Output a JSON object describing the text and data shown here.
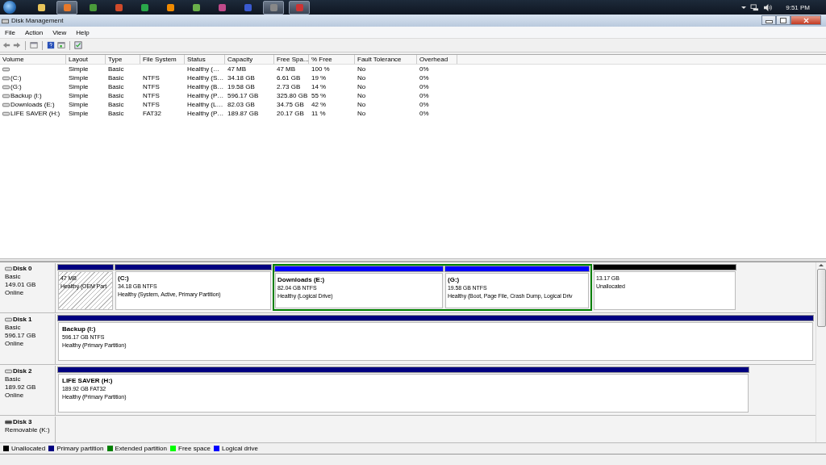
{
  "taskbar": {
    "apps": [
      {
        "selected": false
      },
      {
        "selected": true
      },
      {
        "selected": false
      },
      {
        "selected": false
      },
      {
        "selected": false
      },
      {
        "selected": false
      },
      {
        "selected": false
      },
      {
        "selected": false
      },
      {
        "selected": false
      },
      {
        "selected": true
      },
      {
        "selected": true
      }
    ],
    "clock": "9:51 PM"
  },
  "window": {
    "title": "Disk Management"
  },
  "menu": [
    "File",
    "Action",
    "View",
    "Help"
  ],
  "volumes": {
    "columns": [
      "Volume",
      "Layout",
      "Type",
      "File System",
      "Status",
      "Capacity",
      "Free Spa...",
      "% Free",
      "Fault Tolerance",
      "Overhead"
    ],
    "rows": [
      [
        "",
        "Simple",
        "Basic",
        "",
        "Healthy (…",
        "47 MB",
        "47 MB",
        "100 %",
        "No",
        "0%"
      ],
      [
        "(C:)",
        "Simple",
        "Basic",
        "NTFS",
        "Healthy (S…",
        "34.18 GB",
        "6.61 GB",
        "19 %",
        "No",
        "0%"
      ],
      [
        "(G:)",
        "Simple",
        "Basic",
        "NTFS",
        "Healthy (B…",
        "19.58 GB",
        "2.73 GB",
        "14 %",
        "No",
        "0%"
      ],
      [
        "Backup (I:)",
        "Simple",
        "Basic",
        "NTFS",
        "Healthy (P…",
        "596.17 GB",
        "325.80 GB",
        "55 %",
        "No",
        "0%"
      ],
      [
        "Downloads (E:)",
        "Simple",
        "Basic",
        "NTFS",
        "Healthy (L…",
        "82.03 GB",
        "34.75 GB",
        "42 %",
        "No",
        "0%"
      ],
      [
        "LIFE SAVER (H:)",
        "Simple",
        "Basic",
        "FAT32",
        "Healthy (P…",
        "189.87 GB",
        "20.17 GB",
        "11 %",
        "No",
        "0%"
      ]
    ]
  },
  "disks": [
    {
      "name": "Disk 0",
      "kind": "fixed",
      "lines": [
        "Basic",
        "149.01 GB",
        "Online"
      ],
      "partitions": [
        {
          "kind": "primary",
          "selected": true,
          "lines": [
            "47 MB",
            "Healthy (OEM Part"
          ]
        },
        {
          "kind": "primary",
          "selected": false,
          "label": "(C:)",
          "lines": [
            "34.18 GB NTFS",
            "Healthy (System, Active, Primary Partition)"
          ]
        },
        {
          "kind": "extended",
          "children": [
            {
              "kind": "logical",
              "selected": false,
              "label": "Downloads  (E:)",
              "lines": [
                "82.04 GB NTFS",
                "Healthy (Logical Drive)"
              ]
            },
            {
              "kind": "logical",
              "selected": false,
              "label": "(G:)",
              "lines": [
                "19.58 GB NTFS",
                "Healthy (Boot, Page File, Crash Dump, Logical Driv"
              ]
            }
          ]
        },
        {
          "kind": "unallocated",
          "selected": false,
          "lines": [
            "13.17 GB",
            "Unallocated"
          ]
        }
      ]
    },
    {
      "name": "Disk 1",
      "kind": "fixed",
      "lines": [
        "Basic",
        "596.17 GB",
        "Online"
      ],
      "partitions": [
        {
          "kind": "primary",
          "selected": false,
          "label": "Backup  (I:)",
          "lines": [
            "596.17 GB NTFS",
            "Healthy (Primary Partition)"
          ]
        }
      ]
    },
    {
      "name": "Disk 2",
      "kind": "fixed",
      "lines": [
        "Basic",
        "189.92 GB",
        "Online"
      ],
      "partitions": [
        {
          "kind": "primary",
          "selected": false,
          "label": "LIFE SAVER  (H:)",
          "lines": [
            "189.92 GB FAT32",
            "Healthy (Primary Partition)"
          ]
        }
      ]
    },
    {
      "name": "Disk 3",
      "kind": "removable",
      "lines": [
        "Removable (K:)"
      ]
    }
  ],
  "legend": [
    {
      "label": "Unallocated",
      "color": "#000000"
    },
    {
      "label": "Primary partition",
      "color": "#000080"
    },
    {
      "label": "Extended partition",
      "color": "#008000"
    },
    {
      "label": "Free space",
      "color": "#00ff00"
    },
    {
      "label": "Logical drive",
      "color": "#0000ff"
    }
  ]
}
